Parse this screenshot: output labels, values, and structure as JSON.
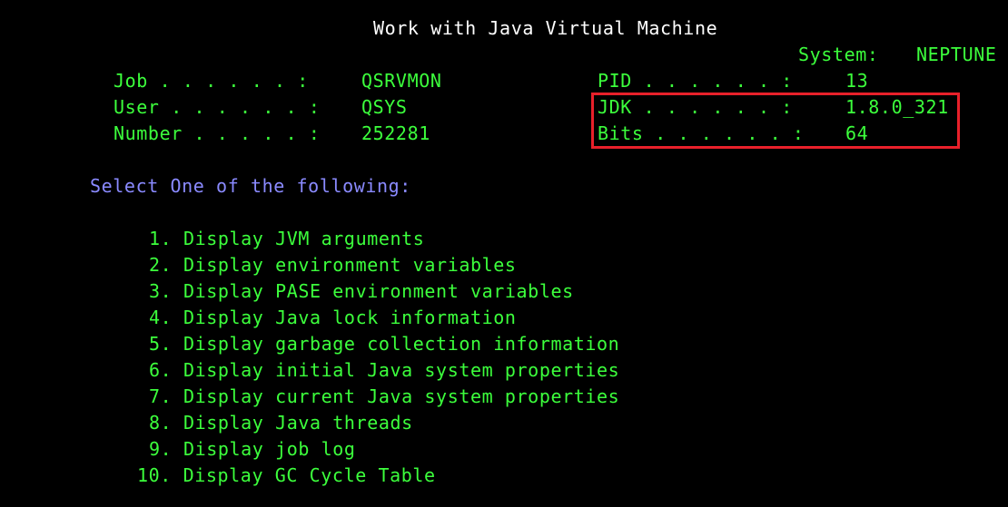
{
  "screen": {
    "title": "Work with Java Virtual Machine",
    "system_label": "System:",
    "system_value": "NEPTUNE"
  },
  "job_info": {
    "job_label": "Job . . . . . . :",
    "job_value": "QSRVMON",
    "user_label": "User . . . . . . :",
    "user_value": "QSYS",
    "number_label": "Number . . . . . :",
    "number_value": "252281",
    "pid_label": "PID . . . . . . :",
    "pid_value": "13",
    "jdk_label": "JDK . . . . . . :",
    "jdk_value": "1.8.0_321",
    "bits_label": "Bits . . . . . . :",
    "bits_value": "64"
  },
  "highlight": {
    "color": "#e8202a"
  },
  "menu": {
    "prompt": "Select One of the following:",
    "options": [
      {
        "num": "1.",
        "label": "Display JVM arguments"
      },
      {
        "num": "2.",
        "label": "Display environment variables"
      },
      {
        "num": "3.",
        "label": "Display PASE environment variables"
      },
      {
        "num": "4.",
        "label": "Display Java lock information"
      },
      {
        "num": "5.",
        "label": "Display garbage collection information"
      },
      {
        "num": "6.",
        "label": "Display initial Java system properties"
      },
      {
        "num": "7.",
        "label": "Display current Java system properties"
      },
      {
        "num": "8.",
        "label": "Display Java threads"
      },
      {
        "num": "9.",
        "label": "Display job log"
      },
      {
        "num": "10.",
        "label": "Display GC Cycle Table"
      }
    ]
  }
}
